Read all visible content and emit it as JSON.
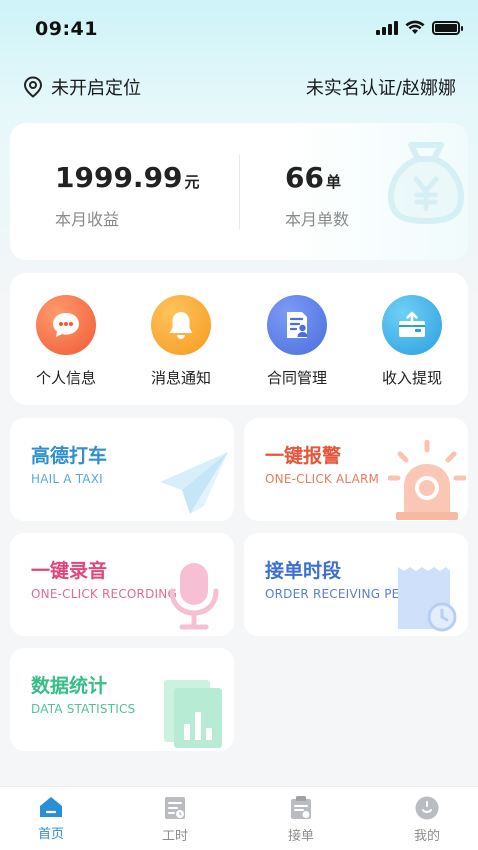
{
  "status_bar": {
    "time": "09:41"
  },
  "header": {
    "location_icon": "location-pin-icon",
    "location_text": "未开启定位",
    "auth_text": "未实名认证/赵娜娜"
  },
  "earnings": {
    "income_value": "1999.99",
    "income_unit": "元",
    "income_label": "本月收益",
    "orders_value": "66",
    "orders_unit": "单",
    "orders_label": "本月单数",
    "decoration_icon": "money-bag-icon"
  },
  "quick_actions": [
    {
      "label": "个人信息",
      "icon": "chat-bubble-icon",
      "color": "#f26a3d"
    },
    {
      "label": "消息通知",
      "icon": "bell-icon",
      "color": "#f9a128"
    },
    {
      "label": "合同管理",
      "icon": "contract-icon",
      "color": "#5a7de6"
    },
    {
      "label": "收入提现",
      "icon": "wallet-withdraw-icon",
      "color": "#3aaee8"
    }
  ],
  "features": [
    {
      "title": "高德打车",
      "subtitle": "HAIL A TAXI",
      "icon": "paper-plane-icon",
      "title_color": "#2f8fd0",
      "sub_color": "#5aa9dc"
    },
    {
      "title": "一键报警",
      "subtitle": "ONE-CLICK ALARM",
      "icon": "alarm-siren-icon",
      "title_color": "#e7553a",
      "sub_color": "#ec7a5e"
    },
    {
      "title": "一键录音",
      "subtitle": "ONE-CLICK RECORDING",
      "icon": "microphone-icon",
      "title_color": "#e0457b",
      "sub_color": "#e66a93"
    },
    {
      "title": "接单时段",
      "subtitle": "ORDER RECEIVING PERIOD",
      "icon": "calendar-clock-icon",
      "title_color": "#3d6fd0",
      "sub_color": "#5a80cf"
    },
    {
      "title": "数据统计",
      "subtitle": "DATA STATISTICS",
      "icon": "bar-chart-doc-icon",
      "title_color": "#37bd86",
      "sub_color": "#4fc595"
    }
  ],
  "tab_bar": [
    {
      "label": "首页",
      "icon": "home-icon",
      "active": true
    },
    {
      "label": "工时",
      "icon": "timesheet-icon",
      "active": false
    },
    {
      "label": "接单",
      "icon": "order-clipboard-icon",
      "active": false
    },
    {
      "label": "我的",
      "icon": "profile-icon",
      "active": false
    }
  ],
  "colors": {
    "accent": "#2a8fd6",
    "background": "#f4f6f7"
  }
}
